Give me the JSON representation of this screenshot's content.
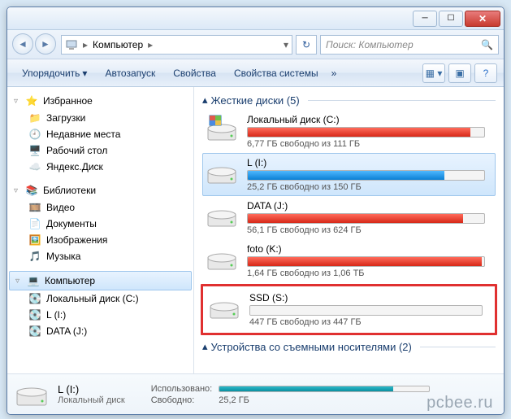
{
  "window": {
    "title": ""
  },
  "nav": {
    "breadcrumbs": [
      "Компьютер"
    ],
    "search_placeholder": "Поиск: Компьютер"
  },
  "toolbar": {
    "organize": "Упорядочить",
    "autoplay": "Автозапуск",
    "properties": "Свойства",
    "system_props": "Свойства системы"
  },
  "tree": {
    "favorites": {
      "label": "Избранное",
      "items": [
        "Загрузки",
        "Недавние места",
        "Рабочий стол",
        "Яндекс.Диск"
      ]
    },
    "libraries": {
      "label": "Библиотеки",
      "items": [
        "Видео",
        "Документы",
        "Изображения",
        "Музыка"
      ]
    },
    "computer": {
      "label": "Компьютер",
      "items": [
        "Локальный диск (C:)",
        "L (I:)",
        "DATA (J:)"
      ]
    }
  },
  "content": {
    "hdd_header": "Жесткие диски (5)",
    "removable_header": "Устройства со съемными носителями (2)",
    "drives": [
      {
        "name": "Локальный диск (C:)",
        "stat": "6,77 ГБ свободно из 111 ГБ",
        "fill_pct": 94,
        "color": "red",
        "os": true,
        "selected": false
      },
      {
        "name": "L (I:)",
        "stat": "25,2 ГБ свободно из 150 ГБ",
        "fill_pct": 83,
        "color": "blue",
        "os": false,
        "selected": true
      },
      {
        "name": "DATA (J:)",
        "stat": "56,1 ГБ свободно из 624 ГБ",
        "fill_pct": 91,
        "color": "red",
        "os": false,
        "selected": false
      },
      {
        "name": "foto (K:)",
        "stat": "1,64 ГБ свободно из 1,06 ТБ",
        "fill_pct": 99,
        "color": "red",
        "os": false,
        "selected": false
      },
      {
        "name": "SSD (S:)",
        "stat": "447 ГБ свободно из 447 ГБ",
        "fill_pct": 1,
        "color": "empty",
        "os": false,
        "selected": false,
        "highlight": true
      }
    ]
  },
  "details": {
    "title": "L (I:)",
    "subtitle": "Локальный диск",
    "used_label": "Использовано:",
    "free_label": "Свободно:",
    "free_value": "25,2 ГБ"
  },
  "watermark": "pcbee.ru"
}
